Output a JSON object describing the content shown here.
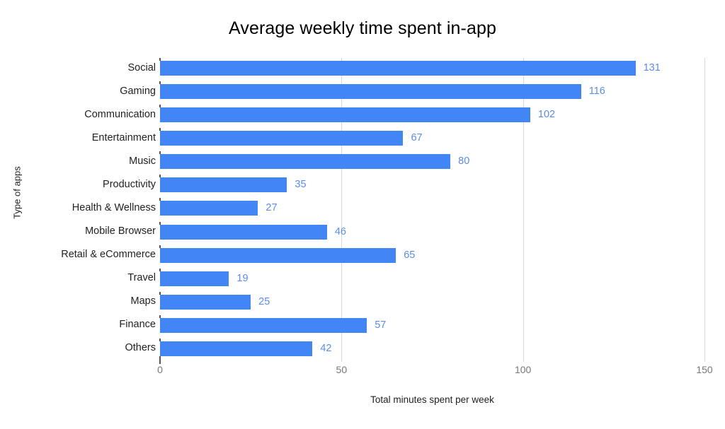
{
  "chart_data": {
    "type": "bar",
    "orientation": "horizontal",
    "title": "Average weekly time spent in-app",
    "xlabel": "Total minutes spent per week",
    "ylabel": "Type of apps",
    "categories": [
      "Social",
      "Gaming",
      "Communication",
      "Entertainment",
      "Music",
      "Productivity",
      "Health & Wellness",
      "Mobile Browser",
      "Retail & eCommerce",
      "Travel",
      "Maps",
      "Finance",
      "Others"
    ],
    "values": [
      131,
      116,
      102,
      67,
      80,
      35,
      27,
      46,
      65,
      19,
      25,
      57,
      42
    ],
    "value_labels": [
      "131",
      "116",
      "102",
      "67",
      "80",
      "35",
      "27",
      "46",
      "65",
      "19",
      "25",
      "57",
      "42"
    ],
    "xlim": [
      0,
      150
    ],
    "xticks": [
      0,
      50,
      100,
      150
    ],
    "xtick_labels": [
      "0",
      "50",
      "100",
      "150"
    ],
    "grid": "vertical",
    "legend": "none",
    "bar_color": "#4285f4",
    "value_label_color": "#5b8ce8",
    "gridline_color": "#d9d9d9",
    "background_color": "#ffffff"
  }
}
